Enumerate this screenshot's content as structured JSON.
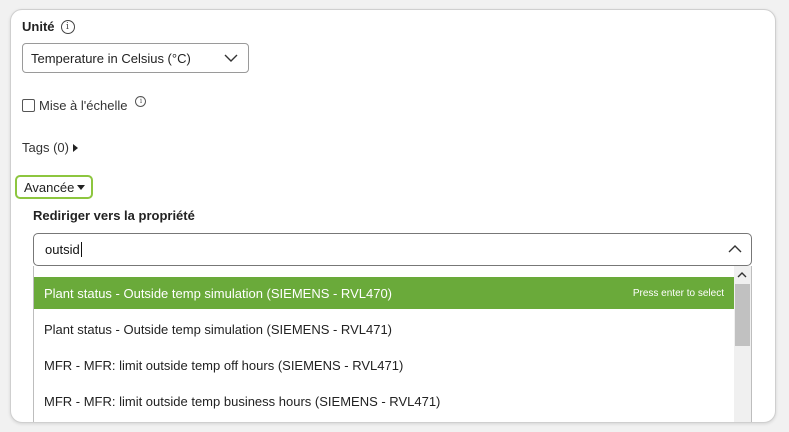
{
  "unit": {
    "label": "Unité",
    "info_glyph": "i",
    "selected_value": "Temperature in Celsius (°C)"
  },
  "scaling": {
    "label": "Mise à l'échelle",
    "checked": false,
    "info_glyph": "i"
  },
  "tags": {
    "label": "Tags (0)"
  },
  "advanced": {
    "label": "Avancée",
    "highlight_color": "#8dc63f"
  },
  "redirect": {
    "label": "Rediriger vers la propriété",
    "search_value": "outsid"
  },
  "dropdown": {
    "selected_color": "#6aaa3a",
    "options": [
      {
        "label": "Plant status - Outside temp simulation (SIEMENS - RVL470)",
        "hint": "Press enter to select",
        "selected": true
      },
      {
        "label": "Plant status - Outside temp simulation (SIEMENS - RVL471)",
        "selected": false
      },
      {
        "label": "MFR - MFR: limit outside temp off hours (SIEMENS - RVL471)",
        "selected": false
      },
      {
        "label": "MFR - MFR: limit outside temp business hours (SIEMENS - RVL471)",
        "selected": false
      }
    ]
  },
  "icons": [
    "info-icon",
    "chevron-down-icon",
    "caret-right-icon",
    "caret-down-icon",
    "chevron-up-icon",
    "scroll-up-arrow-icon"
  ]
}
